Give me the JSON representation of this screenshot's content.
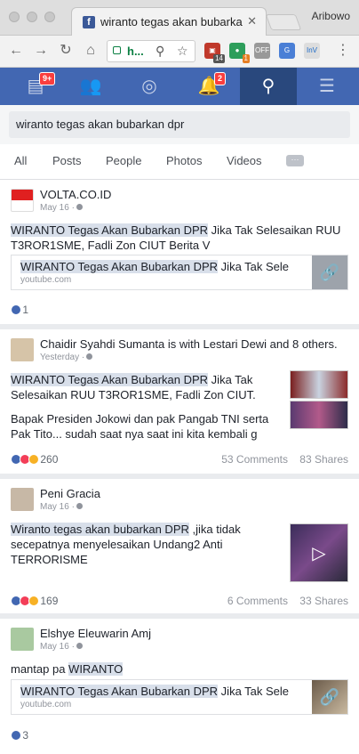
{
  "browser": {
    "tab_title": "wiranto tegas akan bubarkan dpr - Facebook",
    "profile_name": "Aribowo",
    "url_short": "h..."
  },
  "fb": {
    "feed_badge": "9+",
    "notif_badge": "2"
  },
  "search": {
    "query": "wiranto tegas akan bubarkan dpr"
  },
  "filters": [
    "All",
    "Posts",
    "People",
    "Photos",
    "Videos"
  ],
  "posts": [
    {
      "author": "VOLTA.CO.ID",
      "date": "May 16 ·",
      "text_hl": "WIRANTO Tegas Akan Bubarkan DPR",
      "text_rest": " Jika Tak Selesaikan RUU T3ROR1SME, Fadli Zon CIUT Berita V",
      "link_title_hl": "WIRANTO Tegas Akan Bubarkan DPR",
      "link_title_rest": " Jika Tak Sele",
      "link_domain": "youtube.com",
      "reaction_count": "1"
    },
    {
      "author": "Chaidir Syahdi Sumanta",
      "author_suffix": " is with Lestari Dewi and 8 others.",
      "date": "Yesterday ·",
      "text_hl": "WIRANTO Tegas Akan Bubarkan DPR",
      "text_rest": " Jika Tak Selesaikan RUU T3ROR1SME, Fadli Zon CIUT.",
      "text2": "Bapak Presiden Jokowi  dan pak Pangab TNI serta Pak Tito... sudah saat nya saat ini kita kembali g",
      "reaction_count": "260",
      "comments": "53 Comments",
      "shares": "83 Shares"
    },
    {
      "author": "Peni Gracia",
      "date": "May 16 ·",
      "text_hl": "Wiranto tegas akan bubarkan DPR",
      "text_rest": " ,jika tidak secepatnya menyelesaikan Undang2 Anti TERRORISME",
      "reaction_count": "169",
      "comments": "6 Comments",
      "shares": "33 Shares"
    },
    {
      "author": "Elshye Eleuwarin Amj",
      "date": "May 16 ·",
      "text_plain": "mantap pa ",
      "text_hl": "WIRANTO",
      "link_title_hl": "WIRANTO Tegas Akan Bubarkan DPR",
      "link_title_rest": " Jika Tak Sele",
      "link_domain": "youtube.com",
      "reaction_count": "3"
    }
  ]
}
